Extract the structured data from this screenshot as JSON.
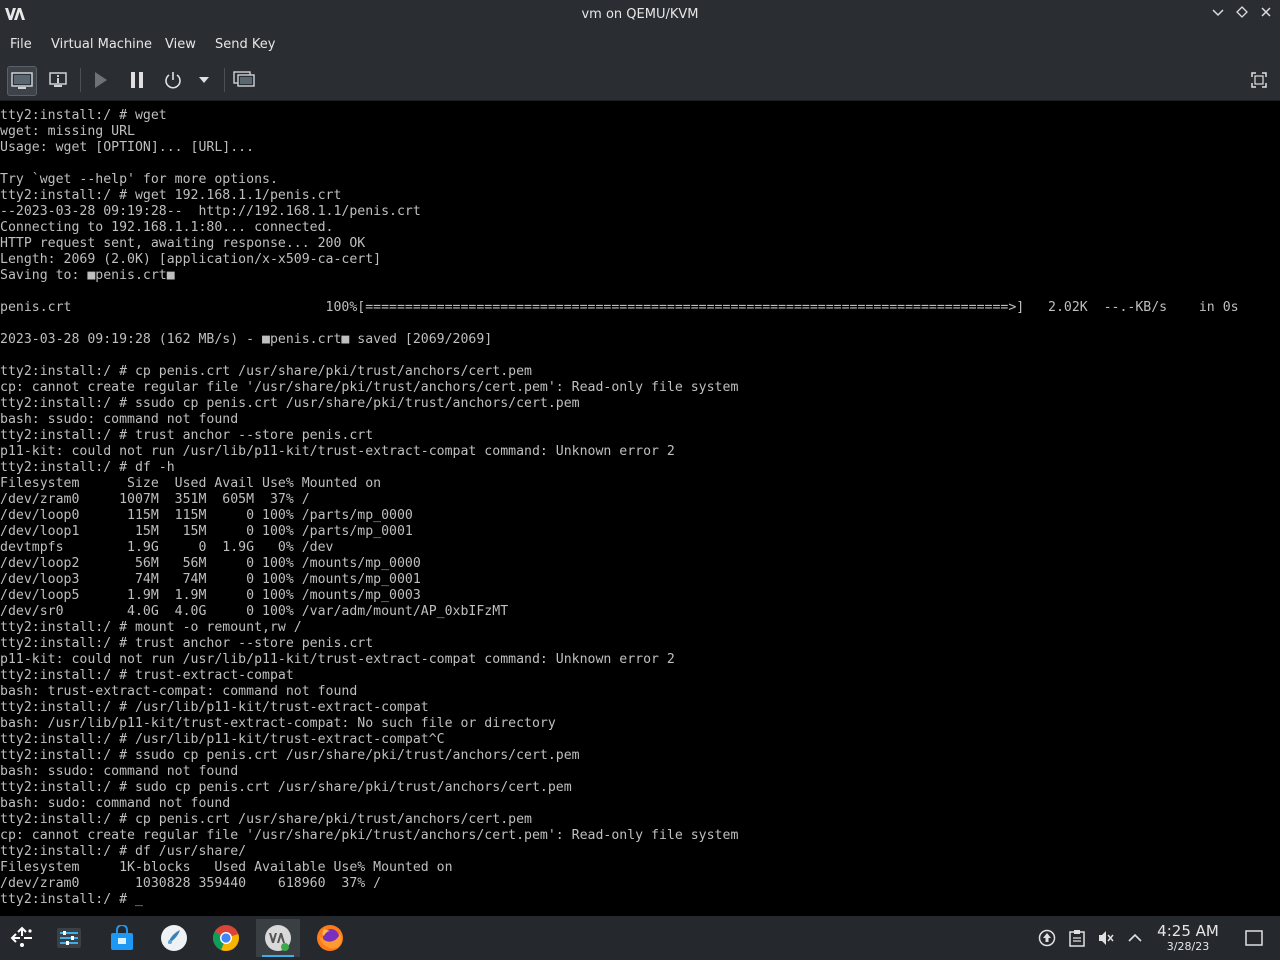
{
  "window": {
    "title": "vm on QEMU/KVM"
  },
  "menu": {
    "items": [
      "File",
      "Virtual Machine",
      "View",
      "Send Key"
    ]
  },
  "toolbar": {
    "buttons": [
      "console-view",
      "details-view",
      "run",
      "pause",
      "shutdown",
      "shutdown-menu",
      "snapshots",
      "fullscreen"
    ]
  },
  "console": {
    "lines": [
      "tty2:install:/ # wget",
      "wget: missing URL",
      "Usage: wget [OPTION]... [URL]...",
      "",
      "Try `wget --help' for more options.",
      "tty2:install:/ # wget 192.168.1.1/penis.crt",
      "--2023-03-28 09:19:28--  http://192.168.1.1/penis.crt",
      "Connecting to 192.168.1.1:80... connected.",
      "HTTP request sent, awaiting response... 200 OK",
      "Length: 2069 (2.0K) [application/x-x509-ca-cert]",
      "Saving to: ■penis.crt■",
      "",
      "penis.crt                                100%[=================================================================================>]   2.02K  --.-KB/s    in 0s",
      "",
      "2023-03-28 09:19:28 (162 MB/s) - ■penis.crt■ saved [2069/2069]",
      "",
      "tty2:install:/ # cp penis.crt /usr/share/pki/trust/anchors/cert.pem",
      "cp: cannot create regular file '/usr/share/pki/trust/anchors/cert.pem': Read-only file system",
      "tty2:install:/ # ssudo cp penis.crt /usr/share/pki/trust/anchors/cert.pem",
      "bash: ssudo: command not found",
      "tty2:install:/ # trust anchor --store penis.crt",
      "p11-kit: could not run /usr/lib/p11-kit/trust-extract-compat command: Unknown error 2",
      "tty2:install:/ # df -h",
      "Filesystem      Size  Used Avail Use% Mounted on",
      "/dev/zram0     1007M  351M  605M  37% /",
      "/dev/loop0      115M  115M     0 100% /parts/mp_0000",
      "/dev/loop1       15M   15M     0 100% /parts/mp_0001",
      "devtmpfs        1.9G     0  1.9G   0% /dev",
      "/dev/loop2       56M   56M     0 100% /mounts/mp_0000",
      "/dev/loop3       74M   74M     0 100% /mounts/mp_0001",
      "/dev/loop5      1.9M  1.9M     0 100% /mounts/mp_0003",
      "/dev/sr0        4.0G  4.0G     0 100% /var/adm/mount/AP_0xbIFzMT",
      "tty2:install:/ # mount -o remount,rw /",
      "tty2:install:/ # trust anchor --store penis.crt",
      "p11-kit: could not run /usr/lib/p11-kit/trust-extract-compat command: Unknown error 2",
      "tty2:install:/ # trust-extract-compat",
      "bash: trust-extract-compat: command not found",
      "tty2:install:/ # /usr/lib/p11-kit/trust-extract-compat",
      "bash: /usr/lib/p11-kit/trust-extract-compat: No such file or directory",
      "tty2:install:/ # /usr/lib/p11-kit/trust-extract-compat^C",
      "tty2:install:/ # ssudo cp penis.crt /usr/share/pki/trust/anchors/cert.pem",
      "bash: ssudo: command not found",
      "tty2:install:/ # sudo cp penis.crt /usr/share/pki/trust/anchors/cert.pem",
      "bash: sudo: command not found",
      "tty2:install:/ # cp penis.crt /usr/share/pki/trust/anchors/cert.pem",
      "cp: cannot create regular file '/usr/share/pki/trust/anchors/cert.pem': Read-only file system",
      "tty2:install:/ # df /usr/share/",
      "Filesystem     1K-blocks   Used Available Use% Mounted on",
      "/dev/zram0       1030828 359440    618960  37% /",
      "tty2:install:/ # "
    ],
    "cursor": "_"
  },
  "taskbar": {
    "apps": [
      "application-launcher",
      "system-settings",
      "discover-store",
      "krita-app",
      "chrome",
      "virt-manager",
      "firefox"
    ],
    "tray": [
      "updates",
      "clipboard",
      "volume-muted",
      "show-hidden"
    ],
    "clock": {
      "time": "4:25 AM",
      "date": "3/28/23"
    }
  },
  "colors": {
    "terminal_fg": "#bfbfbf",
    "terminal_bg": "#000000",
    "chrome_bg": "#2a2e32",
    "accent": "#3daee9"
  }
}
